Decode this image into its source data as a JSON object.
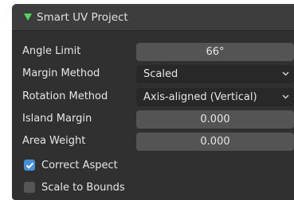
{
  "panel": {
    "title": "Smart UV Project",
    "accent_color": "#52d45e"
  },
  "fields": {
    "angle_limit": {
      "label": "Angle Limit",
      "value": "66°"
    },
    "margin_method": {
      "label": "Margin Method",
      "value": "Scaled"
    },
    "rotation_method": {
      "label": "Rotation Method",
      "value": "Axis-aligned (Vertical)"
    },
    "island_margin": {
      "label": "Island Margin",
      "value": "0.000"
    },
    "area_weight": {
      "label": "Area Weight",
      "value": "0.000"
    }
  },
  "options": {
    "correct_aspect": {
      "label": "Correct Aspect",
      "checked": true
    },
    "scale_to_bounds": {
      "label": "Scale to Bounds",
      "checked": false
    }
  },
  "colors": {
    "checkbox_on": "#4a8fd6"
  }
}
